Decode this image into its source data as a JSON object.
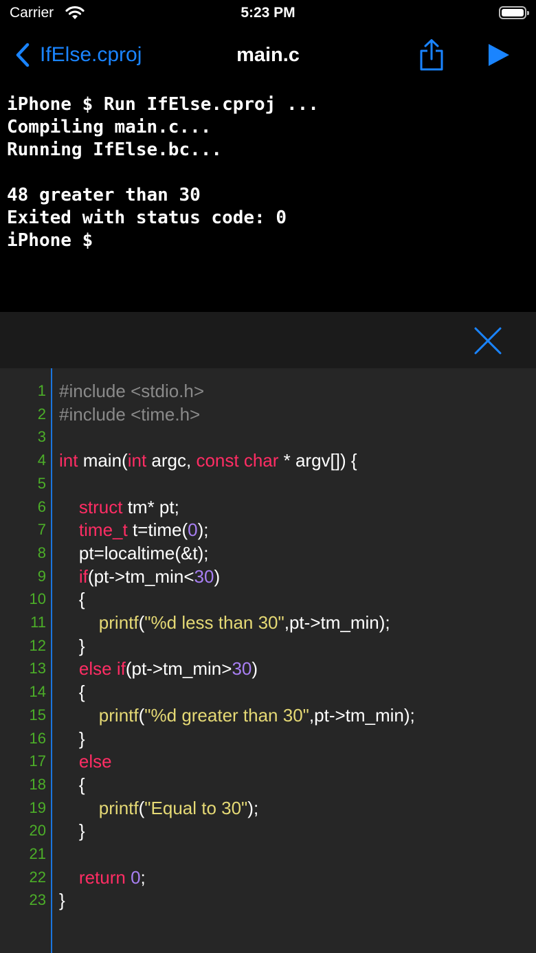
{
  "status_bar": {
    "carrier": "Carrier",
    "time": "5:23 PM"
  },
  "nav": {
    "back_label": "IfElse.cproj",
    "title": "main.c"
  },
  "console": {
    "lines": [
      "iPhone $ Run IfElse.cproj ...",
      "Compiling main.c...",
      "Running IfElse.bc...",
      "",
      "48 greater than 30",
      "Exited with status code: 0",
      "iPhone $"
    ]
  },
  "editor": {
    "lines": [
      {
        "n": "1",
        "code": "#include <stdio.h>"
      },
      {
        "n": "2",
        "code": "#include <time.h>"
      },
      {
        "n": "3",
        "code": ""
      },
      {
        "n": "4",
        "code": "int main(int argc, const char * argv[]) {"
      },
      {
        "n": "5",
        "code": ""
      },
      {
        "n": "6",
        "code": "    struct tm* pt;"
      },
      {
        "n": "7",
        "code": "    time_t t=time(0);"
      },
      {
        "n": "8",
        "code": "    pt=localtime(&t);"
      },
      {
        "n": "9",
        "code": "    if(pt->tm_min<30)"
      },
      {
        "n": "10",
        "code": "    {"
      },
      {
        "n": "11",
        "code": "        printf(\"%d less than 30\",pt->tm_min);"
      },
      {
        "n": "12",
        "code": "    }"
      },
      {
        "n": "13",
        "code": "    else if(pt->tm_min>30)"
      },
      {
        "n": "14",
        "code": "    {"
      },
      {
        "n": "15",
        "code": "        printf(\"%d greater than 30\",pt->tm_min);"
      },
      {
        "n": "16",
        "code": "    }"
      },
      {
        "n": "17",
        "code": "    else"
      },
      {
        "n": "18",
        "code": "    {"
      },
      {
        "n": "19",
        "code": "        printf(\"Equal to 30\");"
      },
      {
        "n": "20",
        "code": "    }"
      },
      {
        "n": "21",
        "code": ""
      },
      {
        "n": "22",
        "code": "    return 0;"
      },
      {
        "n": "23",
        "code": "}"
      }
    ]
  },
  "colors": {
    "accent": "#1a84ff",
    "keyword": "#ff2d64",
    "number": "#a87ff3",
    "string": "#e5d975",
    "comment": "#8a8a8a",
    "line_number": "#4caf28"
  },
  "icons": {
    "back": "chevron-left-icon",
    "share": "share-icon",
    "run": "play-icon",
    "close": "close-icon"
  }
}
